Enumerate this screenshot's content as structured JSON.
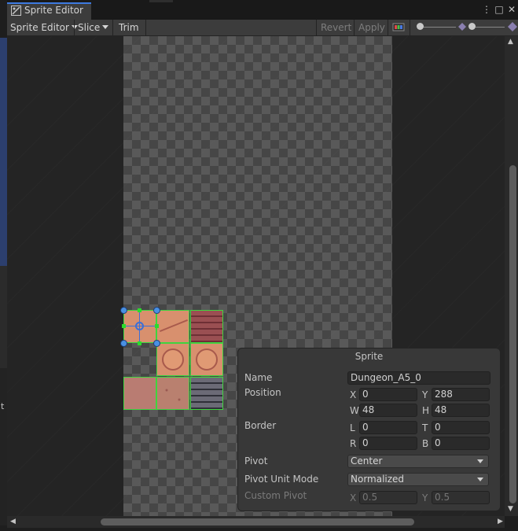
{
  "window": {
    "tab_title": "Sprite Editor",
    "controls": {
      "menu": "⋮",
      "maximize": "□",
      "close": "✕"
    }
  },
  "toolbar": {
    "sprite_editor_menu": "Sprite Editor",
    "slice_menu": "Slice",
    "trim": "Trim",
    "revert": "Revert",
    "apply": "Apply"
  },
  "background_hint": {
    "left_letter": "t"
  },
  "sprite_panel": {
    "title": "Sprite",
    "name_label": "Name",
    "name_value": "Dungeon_A5_0",
    "position_label": "Position",
    "x_label": "X",
    "x_value": "0",
    "y_label": "Y",
    "y_value": "288",
    "w_label": "W",
    "w_value": "48",
    "h_label": "H",
    "h_value": "48",
    "border_label": "Border",
    "l_label": "L",
    "l_value": "0",
    "t_label": "T",
    "t_value": "0",
    "r_label": "R",
    "r_value": "0",
    "b_label": "B",
    "b_value": "0",
    "pivot_label": "Pivot",
    "pivot_value": "Center",
    "pivot_unit_mode_label": "Pivot Unit Mode",
    "pivot_unit_mode_value": "Normalized",
    "custom_pivot_label": "Custom Pivot",
    "custom_x_label": "X",
    "custom_x_value": "0.5",
    "custom_y_label": "Y",
    "custom_y_value": "0.5"
  },
  "colors": {
    "selection_outline": "#3fd43f",
    "handle": "#4a90e2",
    "tab_accent": "#3d7ae0"
  }
}
